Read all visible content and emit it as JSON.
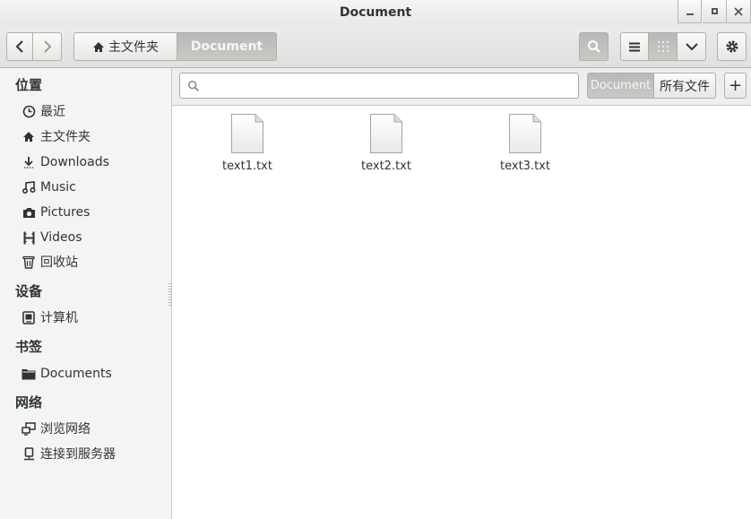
{
  "window": {
    "title": "Document"
  },
  "window_controls": {
    "minimize": "_",
    "maximize": "□",
    "close": "✕"
  },
  "toolbar": {
    "path": [
      {
        "label": "主文件夹",
        "icon": "home-icon"
      },
      {
        "label": "Document"
      }
    ]
  },
  "search": {
    "placeholder": ""
  },
  "search_scope": {
    "current": "Document",
    "all": "所有文件",
    "add": "+"
  },
  "sidebar": {
    "sections": [
      {
        "title": "位置",
        "items": [
          {
            "label": "最近",
            "icon": "clock-icon"
          },
          {
            "label": "主文件夹",
            "icon": "home-icon"
          },
          {
            "label": "Downloads",
            "icon": "download-icon"
          },
          {
            "label": "Music",
            "icon": "music-icon"
          },
          {
            "label": "Pictures",
            "icon": "camera-icon"
          },
          {
            "label": "Videos",
            "icon": "film-icon"
          },
          {
            "label": "回收站",
            "icon": "trash-icon"
          }
        ]
      },
      {
        "title": "设备",
        "items": [
          {
            "label": "计算机",
            "icon": "computer-icon"
          }
        ]
      },
      {
        "title": "书签",
        "items": [
          {
            "label": "Documents",
            "icon": "folder-icon"
          }
        ]
      },
      {
        "title": "网络",
        "items": [
          {
            "label": "浏览网络",
            "icon": "network-icon"
          },
          {
            "label": "连接到服务器",
            "icon": "server-icon"
          }
        ]
      }
    ]
  },
  "files": [
    {
      "name": "text1.txt",
      "icon": "text-file-icon"
    },
    {
      "name": "text2.txt",
      "icon": "text-file-icon"
    },
    {
      "name": "text3.txt",
      "icon": "text-file-icon"
    }
  ]
}
